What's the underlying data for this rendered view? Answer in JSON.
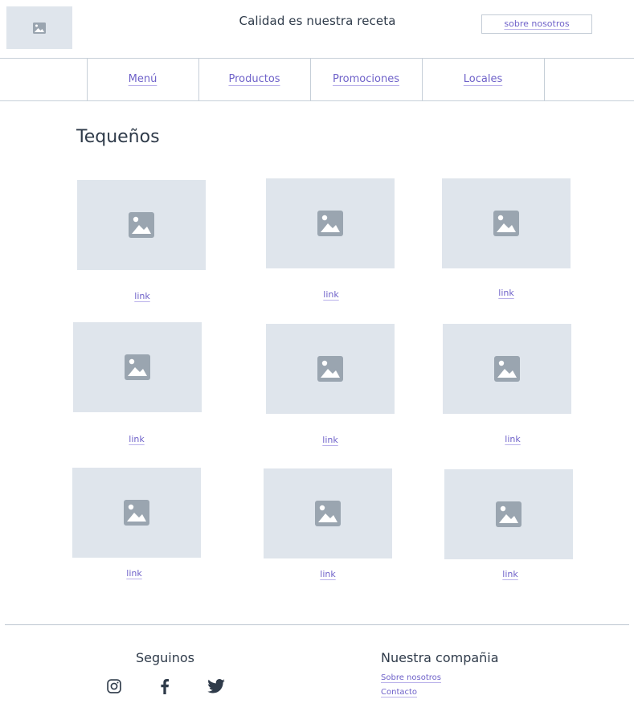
{
  "header": {
    "logo_icon": "image-placeholder-icon",
    "tagline": "Calidad es nuestra receta",
    "about_button": "sobre nosotros"
  },
  "nav": {
    "items": [
      {
        "label": "Menú"
      },
      {
        "label": "Productos"
      },
      {
        "label": "Promociones"
      },
      {
        "label": "Locales"
      }
    ]
  },
  "main": {
    "title": "Tequeños",
    "cards": [
      {
        "link": "link",
        "image_icon": "image-placeholder-icon"
      },
      {
        "link": "link",
        "image_icon": "image-placeholder-icon"
      },
      {
        "link": "link",
        "image_icon": "image-placeholder-icon"
      },
      {
        "link": "link",
        "image_icon": "image-placeholder-icon"
      },
      {
        "link": "link",
        "image_icon": "image-placeholder-icon"
      },
      {
        "link": "link",
        "image_icon": "image-placeholder-icon"
      },
      {
        "link": "link",
        "image_icon": "image-placeholder-icon"
      },
      {
        "link": "link",
        "image_icon": "image-placeholder-icon"
      },
      {
        "link": "link",
        "image_icon": "image-placeholder-icon"
      }
    ]
  },
  "footer": {
    "follow_title": "Seguinos",
    "social": [
      "instagram-icon",
      "facebook-icon",
      "twitter-icon"
    ],
    "company_title": "Nuestra compañia",
    "links": [
      "Sobre nosotros",
      "Contacto"
    ]
  },
  "colors": {
    "link": "#6f62c9",
    "placeholder_bg": "#dfe5ec",
    "placeholder_icon": "#9aa5b0",
    "text": "#2f3b4a",
    "border": "#c6cfd8"
  }
}
